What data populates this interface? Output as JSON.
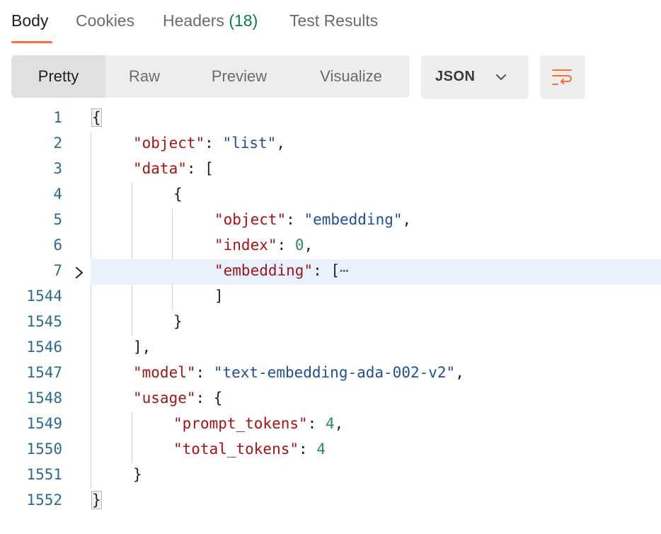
{
  "tabs": [
    {
      "label": "Body"
    },
    {
      "label": "Cookies"
    },
    {
      "label": "Headers ",
      "count": "(18)"
    },
    {
      "label": "Test Results"
    }
  ],
  "view_modes": [
    "Pretty",
    "Raw",
    "Preview",
    "Visualize"
  ],
  "format": {
    "selected": "JSON",
    "icon": "chevron-down-icon"
  },
  "wrap_button": {
    "icon": "wrap-lines-icon"
  },
  "colors": {
    "accent": "#ff6c37",
    "key": "#a31515",
    "string": "#1f4f96",
    "number": "#2e8b57",
    "line_number": "#2c6a8f",
    "highlight": "#e8f1fd"
  },
  "lines": [
    {
      "n": "1"
    },
    {
      "n": "2"
    },
    {
      "n": "3"
    },
    {
      "n": "4"
    },
    {
      "n": "5"
    },
    {
      "n": "6"
    },
    {
      "n": "7"
    },
    {
      "n": "1544"
    },
    {
      "n": "1545"
    },
    {
      "n": "1546"
    },
    {
      "n": "1547"
    },
    {
      "n": "1548"
    },
    {
      "n": "1549"
    },
    {
      "n": "1550"
    },
    {
      "n": "1551"
    },
    {
      "n": "1552"
    }
  ],
  "json": {
    "object_key": "\"object\"",
    "object_val": "\"list\"",
    "data_key": "\"data\"",
    "item_object_key": "\"object\"",
    "item_object_val": "\"embedding\"",
    "index_key": "\"index\"",
    "index_val": "0",
    "embedding_key": "\"embedding\"",
    "collapsed": "⋯",
    "model_key": "\"model\"",
    "model_val": "\"text-embedding-ada-002-v2\"",
    "usage_key": "\"usage\"",
    "prompt_tokens_key": "\"prompt_tokens\"",
    "prompt_tokens_val": "4",
    "total_tokens_key": "\"total_tokens\"",
    "total_tokens_val": "4"
  }
}
